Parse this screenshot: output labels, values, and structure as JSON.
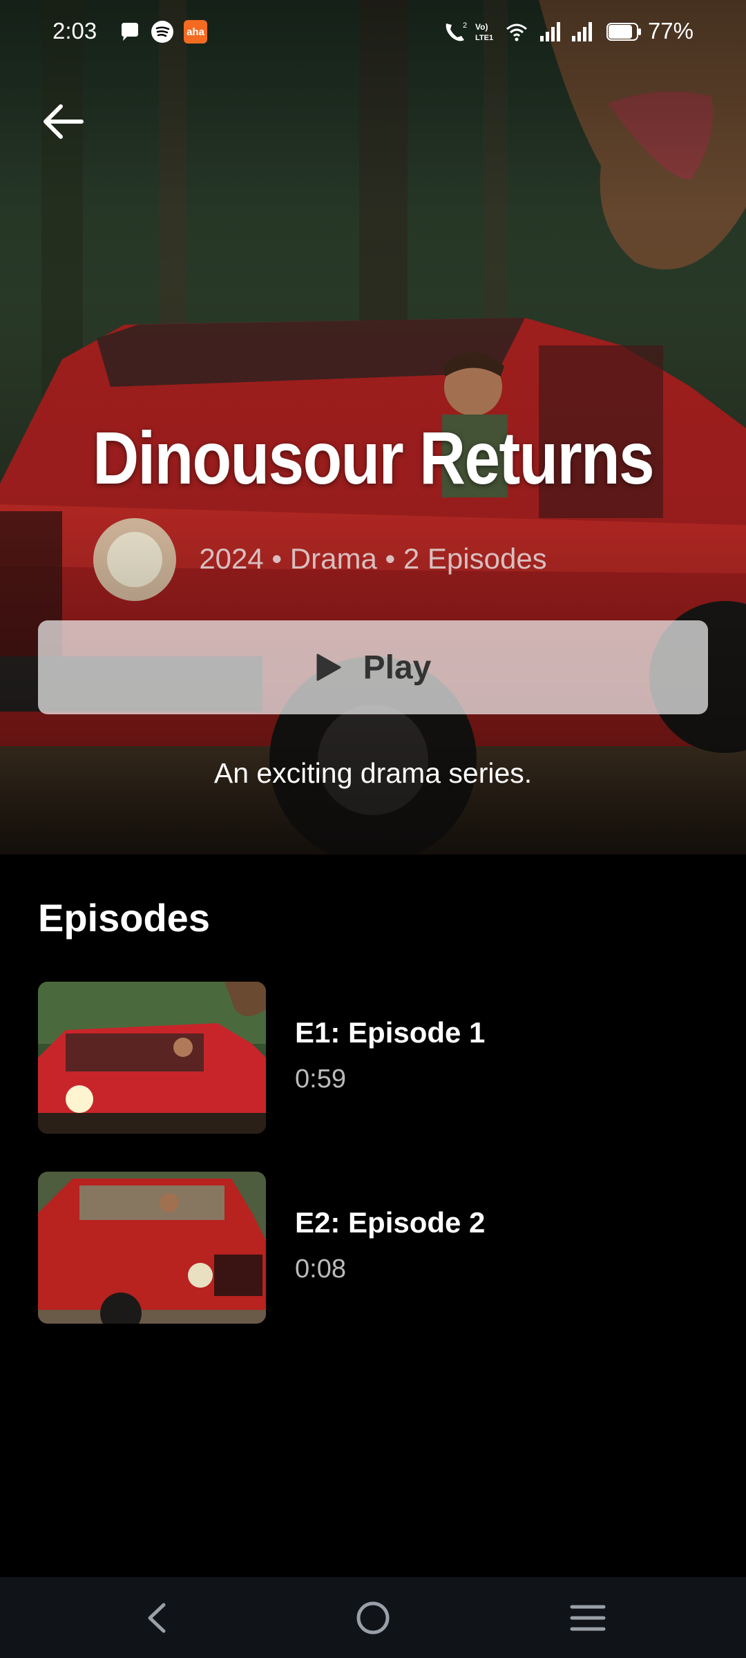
{
  "status_bar": {
    "time": "2:03",
    "battery": "77%",
    "icons": [
      "chat-bubble-icon",
      "spotify-icon",
      "aha-app-icon",
      "wifi-call-icon",
      "volte-icon",
      "wifi-icon",
      "signal-icon",
      "signal-icon",
      "battery-icon"
    ],
    "aha_label": "aha"
  },
  "show": {
    "title": "Dinousour Returns",
    "meta": "2024 • Drama • 2 Episodes",
    "play_label": "Play",
    "description": "An exciting drama series."
  },
  "episodes_section": {
    "title": "Episodes",
    "items": [
      {
        "title": "E1: Episode 1",
        "duration": "0:59"
      },
      {
        "title": "E2: Episode 2",
        "duration": "0:08"
      }
    ]
  },
  "nav": {
    "icons": [
      "back-nav-icon",
      "home-nav-icon",
      "menu-nav-icon"
    ]
  },
  "colors": {
    "background": "#000000",
    "accent_red": "#c8252a",
    "play_button_bg": "#f0f0f0"
  }
}
